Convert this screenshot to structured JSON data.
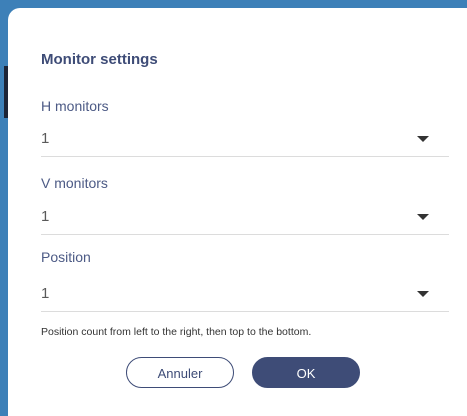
{
  "dialog": {
    "title": "Monitor settings",
    "fields": [
      {
        "label": "H monitors",
        "value": "1"
      },
      {
        "label": "V monitors",
        "value": "1"
      },
      {
        "label": "Position",
        "value": "1"
      }
    ],
    "hint": "Position count from left to the right, then top to the bottom.",
    "cancel_label": "Annuler",
    "ok_label": "OK"
  },
  "colors": {
    "backdrop": "#3d80b8",
    "accent": "#3e4c77",
    "dialog_bg": "#ffffff"
  },
  "icons": {
    "dropdown": "caret-down-icon"
  }
}
